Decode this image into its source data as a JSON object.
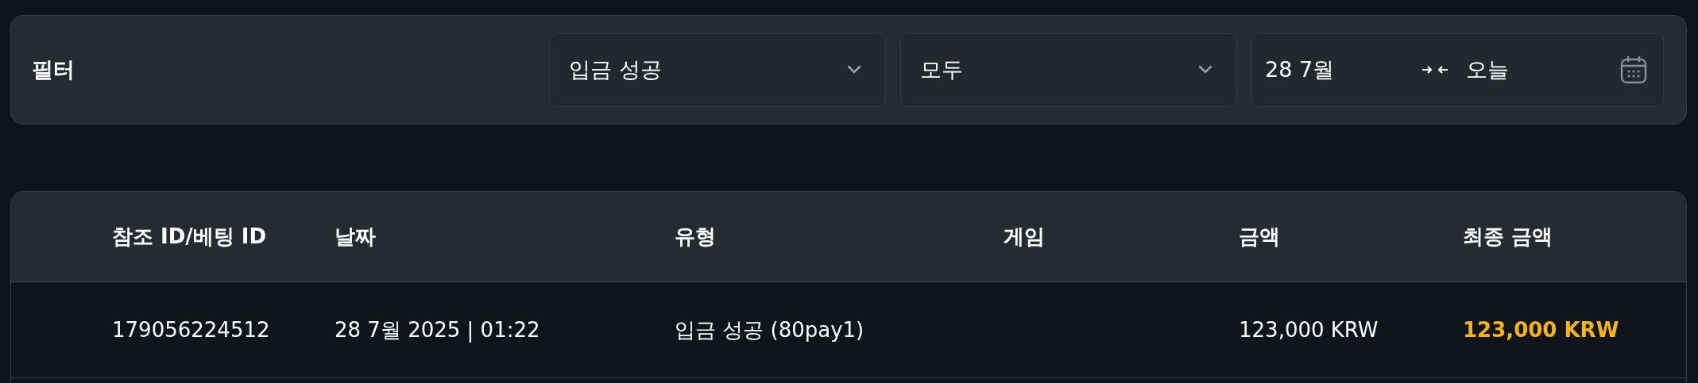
{
  "filter": {
    "title": "필터",
    "selects": [
      {
        "value": "입금 성공"
      },
      {
        "value": "모두"
      }
    ],
    "date_range": {
      "start": "28 7월",
      "end": "오늘"
    }
  },
  "table": {
    "columns": [
      "참조 ID/베팅 ID",
      "날짜",
      "유형",
      "게임",
      "금액",
      "최종 금액"
    ],
    "rows": [
      {
        "cells": [
          "179056224512",
          "28 7월 2025 | 01:22",
          "입금 성공 (80pay1)",
          "",
          "123,000 KRW",
          "123,000 KRW"
        ],
        "highlight_last": true
      }
    ]
  }
}
